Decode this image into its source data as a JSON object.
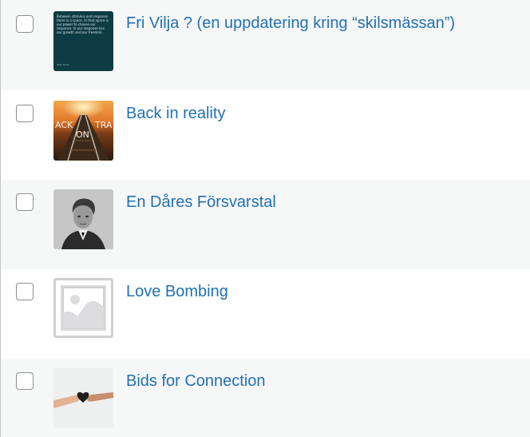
{
  "posts": [
    {
      "title": "Fri Vilja ? (en uppdatering kring “skilsmässan”)",
      "thumbnail": "quote-image",
      "thumbnail_text": "Between stimulus and response there is a space. In that space is our power to choose our response. In our response lies our growth and our freedom.",
      "thumbnail_author": "Viktor Frankl"
    },
    {
      "title": "Back in reality",
      "thumbnail": "railroad-sunset-image",
      "thumbnail_text": [
        "ACK",
        "ON",
        "TRA"
      ]
    },
    {
      "title": "En Dåres Försvarstal",
      "thumbnail": "portrait-photo"
    },
    {
      "title": "Love Bombing",
      "thumbnail": "placeholder-image-icon"
    },
    {
      "title": "Bids for Connection",
      "thumbnail": "hands-holding-heart-image"
    }
  ],
  "colors": {
    "link": "#2271b1",
    "row_alt": "#f6f7f7",
    "row_plain": "#ffffff",
    "checkbox_border": "#8c8f94"
  }
}
